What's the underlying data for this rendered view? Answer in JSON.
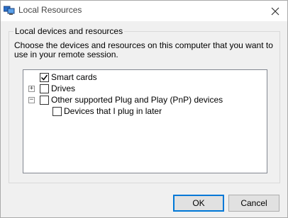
{
  "window": {
    "title": "Local Resources"
  },
  "group": {
    "legend": "Local devices and resources",
    "description": "Choose the devices and resources on this computer that you want to use in your remote session."
  },
  "tree": [
    {
      "label": "Smart cards",
      "checked": true,
      "expander": ""
    },
    {
      "label": "Drives",
      "checked": false,
      "expander": "+"
    },
    {
      "label": "Other supported Plug and Play (PnP) devices",
      "checked": false,
      "expander": "−"
    },
    {
      "label": "Devices that I plug in later",
      "checked": false,
      "expander": ""
    }
  ],
  "buttons": {
    "ok": "OK",
    "cancel": "Cancel"
  }
}
